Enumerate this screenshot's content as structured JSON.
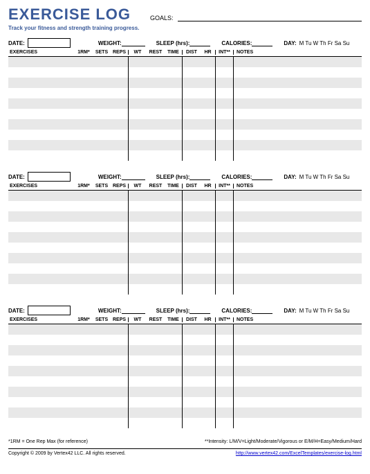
{
  "header": {
    "title": "EXERCISE LOG",
    "goals_label": "GOALS:",
    "subtitle": "Track your fitness and strength training progress."
  },
  "meta": {
    "date_label": "DATE:",
    "weight_label": "WEIGHT:",
    "sleep_label": "SLEEP (hrs):",
    "calories_label": "CALORIES:",
    "day_label": "DAY:",
    "days": "M  Tu  W  Th  Fr  Sa  Su"
  },
  "columns": {
    "exercises": "EXERCISES",
    "one_rm": "1RM*",
    "sets": "SETS",
    "reps": "REPS",
    "wt": "WT",
    "rest": "REST",
    "time": "TIME",
    "dist": "DIST",
    "hr": "HR",
    "int": "INT**",
    "notes": "NOTES"
  },
  "footnotes": {
    "left": "*1RM = One Rep Max (for reference)",
    "right": "**Intensity: L/M/V=Light/Moderate/Vigorous or E/M/H=Easy/Medium/Hard"
  },
  "footer": {
    "copyright": "Copyright © 2009 by Vertex42 LLC. All rights reserved.",
    "url": "http://www.vertex42.com/ExcelTemplates/exercise-log.html"
  }
}
